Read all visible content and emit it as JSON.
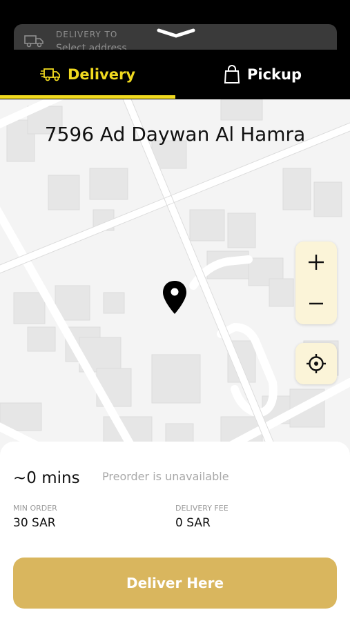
{
  "header": {
    "delivery_to_label": "DELIVERY TO",
    "delivery_to_value": "Select address"
  },
  "tabs": [
    {
      "label": "Delivery",
      "active": true
    },
    {
      "label": "Pickup",
      "active": false
    }
  ],
  "map": {
    "address": "7596 Ad Daywan Al Hamra",
    "zoom_in_icon": "plus-icon",
    "zoom_out_icon": "minus-icon",
    "locate_icon": "crosshair-icon"
  },
  "sheet": {
    "eta": "~0 mins",
    "preorder_note": "Preorder is unavailable",
    "min_order_label": "MIN ORDER",
    "min_order_value": "30 SAR",
    "delivery_fee_label": "DELIVERY FEE",
    "delivery_fee_value": "0 SAR",
    "cta_label": "Deliver Here"
  },
  "colors": {
    "accent_yellow": "#f0d91f",
    "button_gold": "#d9b65e",
    "control_bg": "#fbf4d8"
  }
}
